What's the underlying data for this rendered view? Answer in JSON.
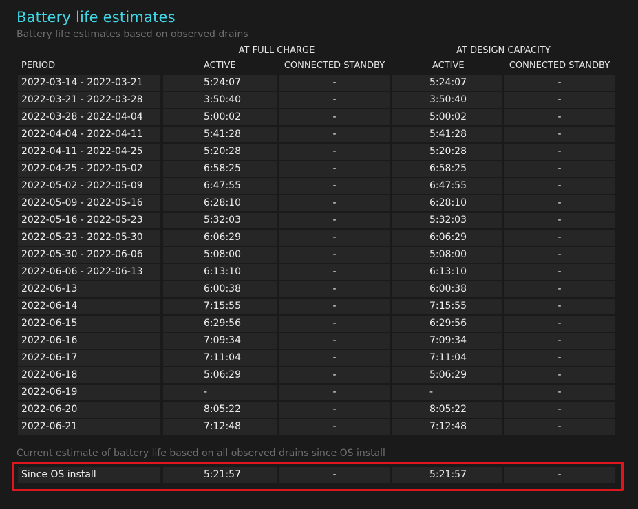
{
  "section": {
    "title": "Battery life estimates",
    "subtitle": "Battery life estimates based on observed drains"
  },
  "table": {
    "group_full": "AT FULL CHARGE",
    "group_design": "AT DESIGN CAPACITY",
    "col_period": "PERIOD",
    "col_active_full": "ACTIVE",
    "col_standby_full": "CONNECTED STANDBY",
    "col_active_design": "ACTIVE",
    "col_standby_design": "CONNECTED STANDBY",
    "rows": [
      {
        "period": "2022-03-14 - 2022-03-21",
        "active_full": "5:24:07",
        "standby_full": "-",
        "active_design": "5:24:07",
        "standby_design": "-"
      },
      {
        "period": "2022-03-21 - 2022-03-28",
        "active_full": "3:50:40",
        "standby_full": "-",
        "active_design": "3:50:40",
        "standby_design": "-"
      },
      {
        "period": "2022-03-28 - 2022-04-04",
        "active_full": "5:00:02",
        "standby_full": "-",
        "active_design": "5:00:02",
        "standby_design": "-"
      },
      {
        "period": "2022-04-04 - 2022-04-11",
        "active_full": "5:41:28",
        "standby_full": "-",
        "active_design": "5:41:28",
        "standby_design": "-"
      },
      {
        "period": "2022-04-11 - 2022-04-25",
        "active_full": "5:20:28",
        "standby_full": "-",
        "active_design": "5:20:28",
        "standby_design": "-"
      },
      {
        "period": "2022-04-25 - 2022-05-02",
        "active_full": "6:58:25",
        "standby_full": "-",
        "active_design": "6:58:25",
        "standby_design": "-"
      },
      {
        "period": "2022-05-02 - 2022-05-09",
        "active_full": "6:47:55",
        "standby_full": "-",
        "active_design": "6:47:55",
        "standby_design": "-"
      },
      {
        "period": "2022-05-09 - 2022-05-16",
        "active_full": "6:28:10",
        "standby_full": "-",
        "active_design": "6:28:10",
        "standby_design": "-"
      },
      {
        "period": "2022-05-16 - 2022-05-23",
        "active_full": "5:32:03",
        "standby_full": "-",
        "active_design": "5:32:03",
        "standby_design": "-"
      },
      {
        "period": "2022-05-23 - 2022-05-30",
        "active_full": "6:06:29",
        "standby_full": "-",
        "active_design": "6:06:29",
        "standby_design": "-"
      },
      {
        "period": "2022-05-30 - 2022-06-06",
        "active_full": "5:08:00",
        "standby_full": "-",
        "active_design": "5:08:00",
        "standby_design": "-"
      },
      {
        "period": "2022-06-06 - 2022-06-13",
        "active_full": "6:13:10",
        "standby_full": "-",
        "active_design": "6:13:10",
        "standby_design": "-"
      },
      {
        "period": "2022-06-13",
        "active_full": "6:00:38",
        "standby_full": "-",
        "active_design": "6:00:38",
        "standby_design": "-"
      },
      {
        "period": "2022-06-14",
        "active_full": "7:15:55",
        "standby_full": "-",
        "active_design": "7:15:55",
        "standby_design": "-"
      },
      {
        "period": "2022-06-15",
        "active_full": "6:29:56",
        "standby_full": "-",
        "active_design": "6:29:56",
        "standby_design": "-"
      },
      {
        "period": "2022-06-16",
        "active_full": "7:09:34",
        "standby_full": "-",
        "active_design": "7:09:34",
        "standby_design": "-"
      },
      {
        "period": "2022-06-17",
        "active_full": "7:11:04",
        "standby_full": "-",
        "active_design": "7:11:04",
        "standby_design": "-"
      },
      {
        "period": "2022-06-18",
        "active_full": "5:06:29",
        "standby_full": "-",
        "active_design": "5:06:29",
        "standby_design": "-"
      },
      {
        "period": "2022-06-19",
        "active_full": "-",
        "standby_full": "-",
        "active_design": "-",
        "standby_design": "-"
      },
      {
        "period": "2022-06-20",
        "active_full": "8:05:22",
        "standby_full": "-",
        "active_design": "8:05:22",
        "standby_design": "-"
      },
      {
        "period": "2022-06-21",
        "active_full": "7:12:48",
        "standby_full": "-",
        "active_design": "7:12:48",
        "standby_design": "-"
      }
    ]
  },
  "current_estimate": {
    "label": "Current estimate of battery life based on all observed drains since OS install",
    "period": "Since OS install",
    "active_full": "5:21:57",
    "standby_full": "-",
    "active_design": "5:21:57",
    "standby_design": "-",
    "highlight_color": "#e0161e"
  },
  "colors": {
    "title": "#3ed8e6",
    "background": "#1a1a1a",
    "cell": "#262626"
  }
}
